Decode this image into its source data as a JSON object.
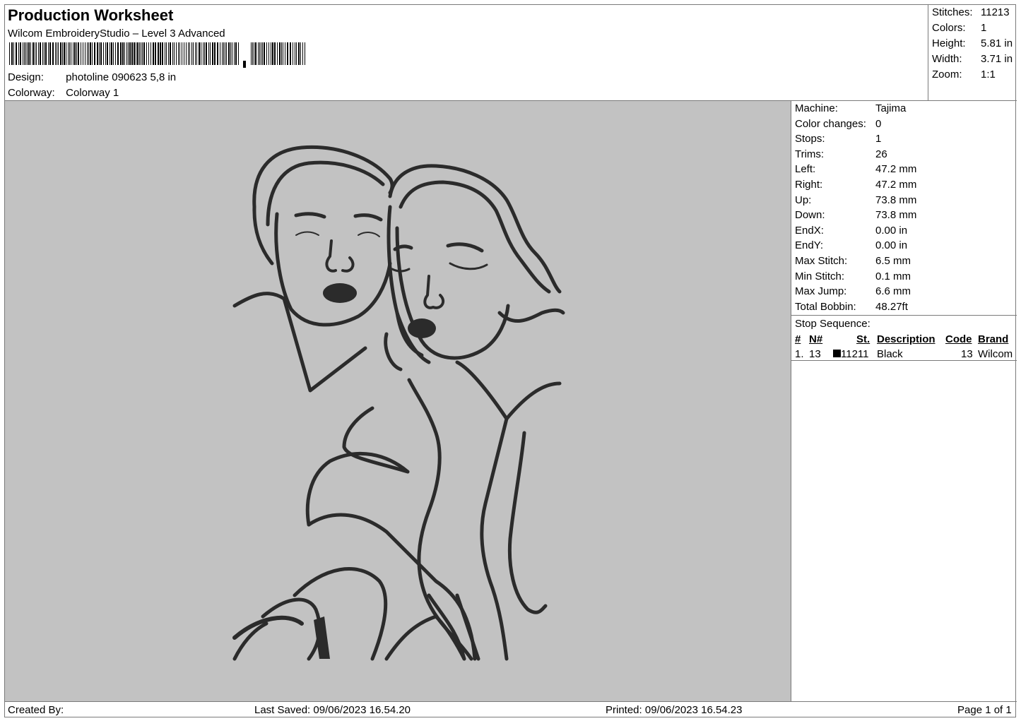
{
  "header": {
    "title": "Production Worksheet",
    "subtitle": "Wilcom EmbroideryStudio – Level 3 Advanced",
    "design_label": "Design:",
    "design_value": "photoline 090623 5,8 in",
    "colorway_label": "Colorway:",
    "colorway_value": "Colorway 1"
  },
  "summary": [
    {
      "label": "Stitches:",
      "value": "11213"
    },
    {
      "label": "Colors:",
      "value": "1"
    },
    {
      "label": "Height:",
      "value": "5.81 in"
    },
    {
      "label": "Width:",
      "value": "3.71 in"
    },
    {
      "label": "Zoom:",
      "value": "1:1"
    }
  ],
  "machine_info": [
    {
      "label": "Machine:",
      "value": "Tajima"
    },
    {
      "label": "Color changes:",
      "value": "0"
    },
    {
      "label": "Stops:",
      "value": "1"
    },
    {
      "label": "Trims:",
      "value": "26"
    },
    {
      "label": "Left:",
      "value": "47.2 mm"
    },
    {
      "label": "Right:",
      "value": "47.2 mm"
    },
    {
      "label": "Up:",
      "value": "73.8 mm"
    },
    {
      "label": "Down:",
      "value": "73.8 mm"
    },
    {
      "label": "EndX:",
      "value": "0.00 in"
    },
    {
      "label": "EndY:",
      "value": "0.00 in"
    },
    {
      "label": "Max Stitch:",
      "value": "6.5 mm"
    },
    {
      "label": "Min Stitch:",
      "value": "0.1 mm"
    },
    {
      "label": "Max Jump:",
      "value": "6.6 mm"
    },
    {
      "label": "Total Bobbin:",
      "value": "48.27ft"
    }
  ],
  "stop_sequence": {
    "label": "Stop Sequence:",
    "columns": {
      "num": "#",
      "n": "N#",
      "st": "St.",
      "description": "Description",
      "code": "Code",
      "brand": "Brand"
    },
    "rows": [
      {
        "num": "1.",
        "n": "13",
        "color": "#000000",
        "st": "11211",
        "description": "Black",
        "code": "13",
        "brand": "Wilcom"
      }
    ]
  },
  "footer": {
    "created_by": "Created By:",
    "last_saved": "Last Saved: 09/06/2023 16.54.20",
    "printed": "Printed: 09/06/2023 16.54.23",
    "page": "Page 1 of 1"
  },
  "colors": {
    "preview_background": "#c2c2c2",
    "thread": "#2b2b2b"
  }
}
